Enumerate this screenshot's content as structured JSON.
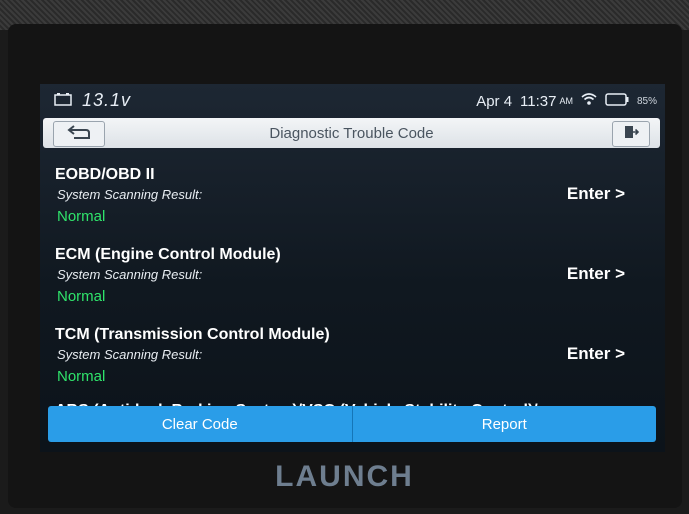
{
  "status": {
    "voltage": "13.1v",
    "date": "Apr 4",
    "time": "11:37",
    "ampm": "AM",
    "battery": "85%"
  },
  "header": {
    "title": "Diagnostic Trouble Code"
  },
  "systems": [
    {
      "name": "EOBD/OBD II",
      "result_label": "System Scanning Result:",
      "result": "Normal",
      "action": "Enter >"
    },
    {
      "name": "ECM (Engine Control Module)",
      "result_label": "System Scanning Result:",
      "result": "Normal",
      "action": "Enter >"
    },
    {
      "name": "TCM (Transmission Control Module)",
      "result_label": "System Scanning Result:",
      "result": "Normal",
      "action": "Enter >"
    },
    {
      "name": "ABS (Anti-lock Braking System)/VSC (Vehicle Stability Control)/"
    }
  ],
  "actions": {
    "clear_code": "Clear Code",
    "report": "Report"
  },
  "brand": {
    "logo": "LAUNCH"
  },
  "colors": {
    "accent": "#2a9de8",
    "status_ok": "#2fe36b"
  }
}
